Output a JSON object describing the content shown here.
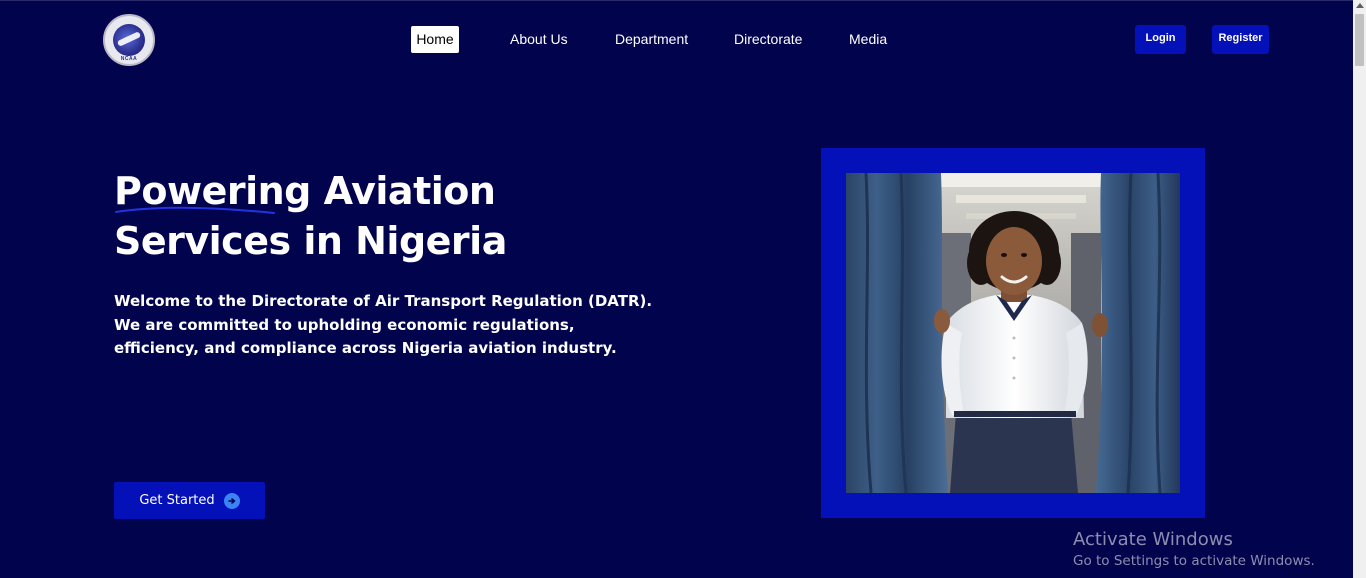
{
  "header": {
    "logo_text": "NCAA",
    "nav": {
      "home": "Home",
      "about": "About Us",
      "department": "Department",
      "directorate": "Directorate",
      "media": "Media"
    },
    "login_label": "Login",
    "register_label": "Register"
  },
  "hero": {
    "title_line1": "Powering Aviation",
    "title_line2": "Services in Nigeria",
    "description": "Welcome to the Directorate of Air Transport Regulation (DATR). We are committed to upholding economic regulations, efficiency, and compliance across Nigeria aviation industry.",
    "cta_label": "Get Started",
    "cta_icon": "arrow-right-circle-icon",
    "image_subject": "flight-attendant-photo"
  },
  "watermark": {
    "title": "Activate Windows",
    "subtitle": "Go to Settings to activate Windows."
  },
  "colors": {
    "background": "#02034d",
    "accent": "#0410b8",
    "arrow_circle": "#3b82f6"
  }
}
